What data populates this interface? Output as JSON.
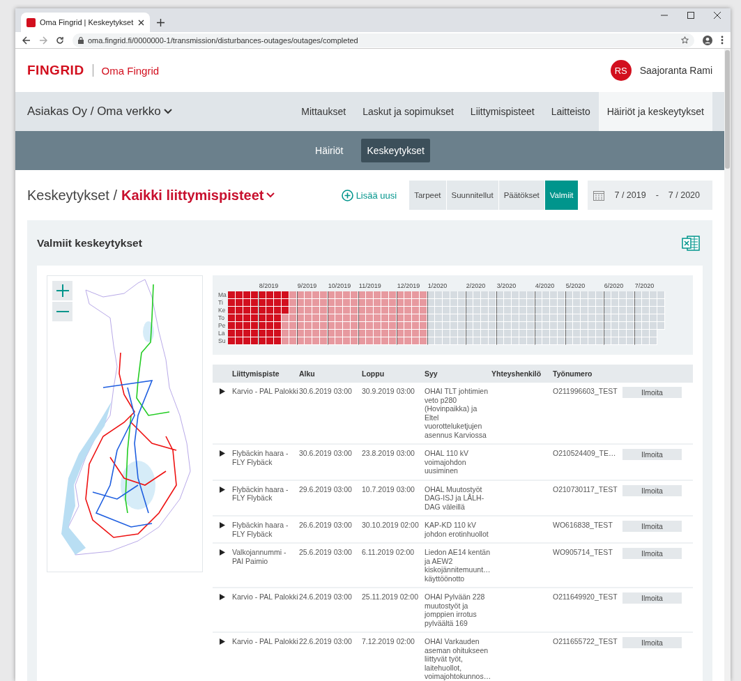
{
  "browser": {
    "tab_title": "Oma Fingrid | Keskeytykset",
    "url": "oma.fingrid.fi/0000000-1/transmission/disturbances-outages/outages/completed"
  },
  "header": {
    "logo": "FINGRID",
    "app_name": "Oma Fingrid",
    "user": {
      "initials": "RS",
      "name": "Saajoranta Rami"
    }
  },
  "nav": {
    "customer": "Asiakas Oy / Oma verkko",
    "items": [
      {
        "label": "Mittaukset",
        "selected": false
      },
      {
        "label": "Laskut ja sopimukset",
        "selected": false
      },
      {
        "label": "Liittymispisteet",
        "selected": false
      },
      {
        "label": "Laitteisto",
        "selected": false
      },
      {
        "label": "Häiriöt ja keskeytykset",
        "selected": true
      }
    ]
  },
  "subnav": [
    {
      "label": "Häiriöt",
      "selected": false
    },
    {
      "label": "Keskeytykset",
      "selected": true
    }
  ],
  "page": {
    "breadcrumb": "Keskeytykset /",
    "scope": "Kaikki liittymispisteet",
    "add_button": "Lisää uusi",
    "status_tabs": [
      {
        "label": "Tarpeet",
        "selected": false
      },
      {
        "label": "Suunnitellut",
        "selected": false
      },
      {
        "label": "Päätökset",
        "selected": false
      },
      {
        "label": "Valmiit",
        "selected": true
      }
    ],
    "date_range": {
      "from": "7 / 2019",
      "separator": "-",
      "to": "7 / 2020"
    }
  },
  "section": {
    "title": "Valmiit keskeytykset"
  },
  "calendar": {
    "day_labels": [
      "Ma",
      "Ti",
      "Ke",
      "To",
      "Pe",
      "La",
      "Su"
    ],
    "columns": [
      {
        "month_start": false
      },
      {
        "month_start": false
      },
      {
        "month_start": false
      },
      {
        "month_start": false
      },
      {
        "month_start": true,
        "label": "8/2019"
      },
      {
        "month_start": false
      },
      {
        "month_start": false
      },
      {
        "month_start": false
      },
      {
        "month_start": false
      },
      {
        "month_start": true,
        "label": "9/2019"
      },
      {
        "month_start": false
      },
      {
        "month_start": false
      },
      {
        "month_start": false
      },
      {
        "month_start": true,
        "label": "10/2019"
      },
      {
        "month_start": false
      },
      {
        "month_start": false
      },
      {
        "month_start": false
      },
      {
        "month_start": true,
        "label": "11/2019"
      },
      {
        "month_start": false
      },
      {
        "month_start": false
      },
      {
        "month_start": false
      },
      {
        "month_start": false
      },
      {
        "month_start": true,
        "label": "12/2019"
      },
      {
        "month_start": false
      },
      {
        "month_start": false
      },
      {
        "month_start": false
      },
      {
        "month_start": true,
        "label": "1/2020"
      },
      {
        "month_start": false
      },
      {
        "month_start": false
      },
      {
        "month_start": false
      },
      {
        "month_start": false
      },
      {
        "month_start": true,
        "label": "2/2020"
      },
      {
        "month_start": false
      },
      {
        "month_start": false
      },
      {
        "month_start": false
      },
      {
        "month_start": true,
        "label": "3/2020"
      },
      {
        "month_start": false
      },
      {
        "month_start": false
      },
      {
        "month_start": false
      },
      {
        "month_start": false
      },
      {
        "month_start": true,
        "label": "4/2020"
      },
      {
        "month_start": false
      },
      {
        "month_start": false
      },
      {
        "month_start": false
      },
      {
        "month_start": true,
        "label": "5/2020"
      },
      {
        "month_start": false
      },
      {
        "month_start": false
      },
      {
        "month_start": false
      },
      {
        "month_start": false
      },
      {
        "month_start": true,
        "label": "6/2020"
      },
      {
        "month_start": false
      },
      {
        "month_start": false
      },
      {
        "month_start": false
      },
      {
        "month_start": true,
        "label": "7/2020"
      },
      {
        "month_start": false
      },
      {
        "month_start": false
      },
      {
        "month_start": false
      }
    ],
    "rows": [
      {
        "cells": [
          {
            "color": "#d20f1e"
          },
          {
            "color": "#d20f1e"
          },
          {
            "color": "#d20f1e"
          },
          {
            "color": "#d20f1e"
          },
          {
            "color": "#d20f1e"
          },
          {
            "color": "#d20f1e"
          },
          {
            "color": "#d20f1e"
          },
          {
            "color": "#d20f1e"
          },
          {
            "color": "#e7999f"
          },
          {
            "color": "#e7999f"
          },
          {
            "color": "#e7999f"
          },
          {
            "color": "#e7999f"
          },
          {
            "color": "#e7999f"
          },
          {
            "color": "#e7999f"
          },
          {
            "color": "#e7999f"
          },
          {
            "color": "#e7999f"
          },
          {
            "color": "#e7999f"
          },
          {
            "color": "#e7999f"
          },
          {
            "color": "#e7999f"
          },
          {
            "color": "#e7999f"
          },
          {
            "color": "#e7999f"
          },
          {
            "color": "#e7999f"
          },
          {
            "color": "#e7999f"
          },
          {
            "color": "#e7999f"
          },
          {
            "color": "#e7999f"
          },
          {
            "color": "#e7999f"
          },
          {
            "color": "#d6dce1"
          },
          {
            "color": "#d6dce1"
          },
          {
            "color": "#d6dce1"
          },
          {
            "color": "#d6dce1"
          },
          {
            "color": "#d6dce1"
          },
          {
            "color": "#d6dce1"
          },
          {
            "color": "#d6dce1"
          },
          {
            "color": "#d6dce1"
          },
          {
            "color": "#d6dce1"
          },
          {
            "color": "#d6dce1"
          },
          {
            "color": "#d6dce1"
          },
          {
            "color": "#d6dce1"
          },
          {
            "color": "#d6dce1"
          },
          {
            "color": "#d6dce1"
          },
          {
            "color": "#d6dce1"
          },
          {
            "color": "#d6dce1"
          },
          {
            "color": "#d6dce1"
          },
          {
            "color": "#d6dce1"
          },
          {
            "color": "#d6dce1"
          },
          {
            "color": "#d6dce1"
          },
          {
            "color": "#d6dce1"
          },
          {
            "color": "#d6dce1"
          },
          {
            "color": "#d6dce1"
          },
          {
            "color": "#d6dce1"
          },
          {
            "color": "#d6dce1"
          },
          {
            "color": "#d6dce1"
          },
          {
            "color": "#d6dce1"
          },
          {
            "color": "#d6dce1"
          },
          {
            "color": "#d6dce1"
          },
          {
            "color": "#d6dce1"
          },
          {
            "color": "#d6dce1"
          }
        ]
      },
      {
        "cells": [
          {
            "color": "#d20f1e"
          },
          {
            "color": "#d20f1e"
          },
          {
            "color": "#d20f1e"
          },
          {
            "color": "#d20f1e"
          },
          {
            "color": "#d20f1e"
          },
          {
            "color": "#d20f1e"
          },
          {
            "color": "#d20f1e"
          },
          {
            "color": "#d20f1e"
          },
          {
            "color": "#e7999f"
          },
          {
            "color": "#e7999f"
          },
          {
            "color": "#e7999f"
          },
          {
            "color": "#e7999f"
          },
          {
            "color": "#e7999f"
          },
          {
            "color": "#e7999f"
          },
          {
            "color": "#e7999f"
          },
          {
            "color": "#e7999f"
          },
          {
            "color": "#e7999f"
          },
          {
            "color": "#e7999f"
          },
          {
            "color": "#e7999f"
          },
          {
            "color": "#e7999f"
          },
          {
            "color": "#e7999f"
          },
          {
            "color": "#e7999f"
          },
          {
            "color": "#e7999f"
          },
          {
            "color": "#e7999f"
          },
          {
            "color": "#e7999f"
          },
          {
            "color": "#e7999f"
          },
          {
            "color": "#d6dce1"
          },
          {
            "color": "#d6dce1"
          },
          {
            "color": "#d6dce1"
          },
          {
            "color": "#d6dce1"
          },
          {
            "color": "#d6dce1"
          },
          {
            "color": "#d6dce1"
          },
          {
            "color": "#d6dce1"
          },
          {
            "color": "#d6dce1"
          },
          {
            "color": "#d6dce1"
          },
          {
            "color": "#d6dce1"
          },
          {
            "color": "#d6dce1"
          },
          {
            "color": "#d6dce1"
          },
          {
            "color": "#d6dce1"
          },
          {
            "color": "#d6dce1"
          },
          {
            "color": "#d6dce1"
          },
          {
            "color": "#d6dce1"
          },
          {
            "color": "#d6dce1"
          },
          {
            "color": "#d6dce1"
          },
          {
            "color": "#d6dce1"
          },
          {
            "color": "#d6dce1"
          },
          {
            "color": "#d6dce1"
          },
          {
            "color": "#d6dce1"
          },
          {
            "color": "#d6dce1"
          },
          {
            "color": "#d6dce1"
          },
          {
            "color": "#d6dce1"
          },
          {
            "color": "#d6dce1"
          },
          {
            "color": "#d6dce1"
          },
          {
            "color": "#d6dce1"
          },
          {
            "color": "#d6dce1"
          },
          {
            "color": "#d6dce1"
          },
          {
            "color": "#d6dce1"
          }
        ]
      },
      {
        "cells": [
          {
            "color": "#d20f1e"
          },
          {
            "color": "#d20f1e"
          },
          {
            "color": "#d20f1e"
          },
          {
            "color": "#d20f1e"
          },
          {
            "color": "#d20f1e"
          },
          {
            "color": "#d20f1e"
          },
          {
            "color": "#d20f1e"
          },
          {
            "color": "#d20f1e"
          },
          {
            "color": "#e7999f"
          },
          {
            "color": "#e7999f"
          },
          {
            "color": "#e7999f"
          },
          {
            "color": "#e7999f"
          },
          {
            "color": "#e7999f"
          },
          {
            "color": "#e7999f"
          },
          {
            "color": "#e7999f"
          },
          {
            "color": "#e7999f"
          },
          {
            "color": "#e7999f"
          },
          {
            "color": "#e7999f"
          },
          {
            "color": "#e7999f"
          },
          {
            "color": "#e7999f"
          },
          {
            "color": "#e7999f"
          },
          {
            "color": "#e7999f"
          },
          {
            "color": "#e7999f"
          },
          {
            "color": "#e7999f"
          },
          {
            "color": "#e7999f"
          },
          {
            "color": "#e7999f"
          },
          {
            "color": "#d6dce1"
          },
          {
            "color": "#d6dce1"
          },
          {
            "color": "#d6dce1"
          },
          {
            "color": "#d6dce1"
          },
          {
            "color": "#d6dce1"
          },
          {
            "color": "#d6dce1"
          },
          {
            "color": "#d6dce1"
          },
          {
            "color": "#d6dce1"
          },
          {
            "color": "#d6dce1"
          },
          {
            "color": "#d6dce1"
          },
          {
            "color": "#d6dce1"
          },
          {
            "color": "#d6dce1"
          },
          {
            "color": "#d6dce1"
          },
          {
            "color": "#d6dce1"
          },
          {
            "color": "#d6dce1"
          },
          {
            "color": "#d6dce1"
          },
          {
            "color": "#d6dce1"
          },
          {
            "color": "#d6dce1"
          },
          {
            "color": "#d6dce1"
          },
          {
            "color": "#d6dce1"
          },
          {
            "color": "#d6dce1"
          },
          {
            "color": "#d6dce1"
          },
          {
            "color": "#d6dce1"
          },
          {
            "color": "#d6dce1"
          },
          {
            "color": "#d6dce1"
          },
          {
            "color": "#d6dce1"
          },
          {
            "color": "#d6dce1"
          },
          {
            "color": "#d6dce1"
          },
          {
            "color": "#d6dce1"
          },
          {
            "color": "#d6dce1"
          },
          {
            "color": "#d6dce1"
          }
        ]
      },
      {
        "cells": [
          {
            "color": "#d20f1e"
          },
          {
            "color": "#d20f1e"
          },
          {
            "color": "#d20f1e"
          },
          {
            "color": "#d20f1e"
          },
          {
            "color": "#d20f1e"
          },
          {
            "color": "#d20f1e"
          },
          {
            "color": "#d20f1e"
          },
          {
            "color": "#e7999f"
          },
          {
            "color": "#e7999f"
          },
          {
            "color": "#e7999f"
          },
          {
            "color": "#e7999f"
          },
          {
            "color": "#e7999f"
          },
          {
            "color": "#e7999f"
          },
          {
            "color": "#e7999f"
          },
          {
            "color": "#e7999f"
          },
          {
            "color": "#e7999f"
          },
          {
            "color": "#e7999f"
          },
          {
            "color": "#e7999f"
          },
          {
            "color": "#e7999f"
          },
          {
            "color": "#e7999f"
          },
          {
            "color": "#e7999f"
          },
          {
            "color": "#e7999f"
          },
          {
            "color": "#e7999f"
          },
          {
            "color": "#e7999f"
          },
          {
            "color": "#e7999f"
          },
          {
            "color": "#e7999f"
          },
          {
            "color": "#d6dce1"
          },
          {
            "color": "#d6dce1"
          },
          {
            "color": "#d6dce1"
          },
          {
            "color": "#d6dce1"
          },
          {
            "color": "#d6dce1"
          },
          {
            "color": "#d6dce1"
          },
          {
            "color": "#d6dce1"
          },
          {
            "color": "#d6dce1"
          },
          {
            "color": "#d6dce1"
          },
          {
            "color": "#d6dce1"
          },
          {
            "color": "#d6dce1"
          },
          {
            "color": "#d6dce1"
          },
          {
            "color": "#d6dce1"
          },
          {
            "color": "#d6dce1"
          },
          {
            "color": "#d6dce1"
          },
          {
            "color": "#d6dce1"
          },
          {
            "color": "#d6dce1"
          },
          {
            "color": "#d6dce1"
          },
          {
            "color": "#d6dce1"
          },
          {
            "color": "#d6dce1"
          },
          {
            "color": "#d6dce1"
          },
          {
            "color": "#d6dce1"
          },
          {
            "color": "#d6dce1"
          },
          {
            "color": "#d6dce1"
          },
          {
            "color": "#d6dce1"
          },
          {
            "color": "#d6dce1"
          },
          {
            "color": "#d6dce1"
          },
          {
            "color": "#d6dce1"
          },
          {
            "color": "#d6dce1"
          },
          {
            "color": "#d6dce1"
          },
          {
            "color": "#d6dce1"
          }
        ]
      },
      {
        "cells": [
          {
            "color": "#d20f1e"
          },
          {
            "color": "#d20f1e"
          },
          {
            "color": "#d20f1e"
          },
          {
            "color": "#d20f1e"
          },
          {
            "color": "#d20f1e"
          },
          {
            "color": "#d20f1e"
          },
          {
            "color": "#d20f1e"
          },
          {
            "color": "#e7999f"
          },
          {
            "color": "#e7999f"
          },
          {
            "color": "#e7999f"
          },
          {
            "color": "#e7999f"
          },
          {
            "color": "#e7999f"
          },
          {
            "color": "#e7999f"
          },
          {
            "color": "#e7999f"
          },
          {
            "color": "#e7999f"
          },
          {
            "color": "#e7999f"
          },
          {
            "color": "#e7999f"
          },
          {
            "color": "#e7999f"
          },
          {
            "color": "#e7999f"
          },
          {
            "color": "#e7999f"
          },
          {
            "color": "#e7999f"
          },
          {
            "color": "#e7999f"
          },
          {
            "color": "#e7999f"
          },
          {
            "color": "#e7999f"
          },
          {
            "color": "#e7999f"
          },
          {
            "color": "#e7999f"
          },
          {
            "color": "#d6dce1"
          },
          {
            "color": "#d6dce1"
          },
          {
            "color": "#d6dce1"
          },
          {
            "color": "#d6dce1"
          },
          {
            "color": "#d6dce1"
          },
          {
            "color": "#d6dce1"
          },
          {
            "color": "#d6dce1"
          },
          {
            "color": "#d6dce1"
          },
          {
            "color": "#d6dce1"
          },
          {
            "color": "#d6dce1"
          },
          {
            "color": "#d6dce1"
          },
          {
            "color": "#d6dce1"
          },
          {
            "color": "#d6dce1"
          },
          {
            "color": "#d6dce1"
          },
          {
            "color": "#d6dce1"
          },
          {
            "color": "#d6dce1"
          },
          {
            "color": "#d6dce1"
          },
          {
            "color": "#d6dce1"
          },
          {
            "color": "#d6dce1"
          },
          {
            "color": "#d6dce1"
          },
          {
            "color": "#d6dce1"
          },
          {
            "color": "#d6dce1"
          },
          {
            "color": "#d6dce1"
          },
          {
            "color": "#d6dce1"
          },
          {
            "color": "#d6dce1"
          },
          {
            "color": "#d6dce1"
          },
          {
            "color": "#d6dce1"
          },
          {
            "color": "#d6dce1"
          },
          {
            "color": "#d6dce1"
          },
          {
            "color": "#d6dce1"
          },
          {
            "color": "#d6dce1"
          }
        ]
      },
      {
        "cells": [
          {
            "color": "#d20f1e"
          },
          {
            "color": "#d20f1e"
          },
          {
            "color": "#d20f1e"
          },
          {
            "color": "#d20f1e"
          },
          {
            "color": "#d20f1e"
          },
          {
            "color": "#d20f1e"
          },
          {
            "color": "#d20f1e"
          },
          {
            "color": "#e7999f"
          },
          {
            "color": "#e7999f"
          },
          {
            "color": "#e7999f"
          },
          {
            "color": "#e7999f"
          },
          {
            "color": "#e7999f"
          },
          {
            "color": "#e7999f"
          },
          {
            "color": "#e7999f"
          },
          {
            "color": "#e7999f"
          },
          {
            "color": "#e7999f"
          },
          {
            "color": "#e7999f"
          },
          {
            "color": "#e7999f"
          },
          {
            "color": "#e7999f"
          },
          {
            "color": "#e7999f"
          },
          {
            "color": "#e7999f"
          },
          {
            "color": "#e7999f"
          },
          {
            "color": "#e7999f"
          },
          {
            "color": "#e7999f"
          },
          {
            "color": "#e7999f"
          },
          {
            "color": "#e7999f"
          },
          {
            "color": "#d6dce1"
          },
          {
            "color": "#d6dce1"
          },
          {
            "color": "#d6dce1"
          },
          {
            "color": "#d6dce1"
          },
          {
            "color": "#d6dce1"
          },
          {
            "color": "#d6dce1"
          },
          {
            "color": "#d6dce1"
          },
          {
            "color": "#d6dce1"
          },
          {
            "color": "#d6dce1"
          },
          {
            "color": "#d6dce1"
          },
          {
            "color": "#d6dce1"
          },
          {
            "color": "#d6dce1"
          },
          {
            "color": "#d6dce1"
          },
          {
            "color": "#d6dce1"
          },
          {
            "color": "#d6dce1"
          },
          {
            "color": "#d6dce1"
          },
          {
            "color": "#d6dce1"
          },
          {
            "color": "#d6dce1"
          },
          {
            "color": "#d6dce1"
          },
          {
            "color": "#d6dce1"
          },
          {
            "color": "#d6dce1"
          },
          {
            "color": "#d6dce1"
          },
          {
            "color": "#d6dce1"
          },
          {
            "color": "#d6dce1"
          },
          {
            "color": "#d6dce1"
          },
          {
            "color": "#d6dce1"
          },
          {
            "color": "#d6dce1"
          },
          {
            "color": "#d6dce1"
          },
          {
            "color": "#d6dce1"
          },
          {
            "color": "#d6dce1"
          }
        ]
      },
      {
        "cells": [
          {
            "color": "#d20f1e"
          },
          {
            "color": "#d20f1e"
          },
          {
            "color": "#d20f1e"
          },
          {
            "color": "#d20f1e"
          },
          {
            "color": "#d20f1e"
          },
          {
            "color": "#d20f1e"
          },
          {
            "color": "#d20f1e"
          },
          {
            "color": "#e7999f"
          },
          {
            "color": "#e7999f"
          },
          {
            "color": "#e7999f"
          },
          {
            "color": "#e7999f"
          },
          {
            "color": "#e7999f"
          },
          {
            "color": "#e7999f"
          },
          {
            "color": "#e7999f"
          },
          {
            "color": "#e7999f"
          },
          {
            "color": "#e7999f"
          },
          {
            "color": "#e7999f"
          },
          {
            "color": "#e7999f"
          },
          {
            "color": "#e7999f"
          },
          {
            "color": "#e7999f"
          },
          {
            "color": "#e7999f"
          },
          {
            "color": "#e7999f"
          },
          {
            "color": "#e7999f"
          },
          {
            "color": "#e7999f"
          },
          {
            "color": "#e7999f"
          },
          {
            "color": "#e7999f"
          },
          {
            "color": "#d6dce1"
          },
          {
            "color": "#d6dce1"
          },
          {
            "color": "#d6dce1"
          },
          {
            "color": "#d6dce1"
          },
          {
            "color": "#d6dce1"
          },
          {
            "color": "#d6dce1"
          },
          {
            "color": "#d6dce1"
          },
          {
            "color": "#d6dce1"
          },
          {
            "color": "#d6dce1"
          },
          {
            "color": "#d6dce1"
          },
          {
            "color": "#d6dce1"
          },
          {
            "color": "#d6dce1"
          },
          {
            "color": "#d6dce1"
          },
          {
            "color": "#d6dce1"
          },
          {
            "color": "#d6dce1"
          },
          {
            "color": "#d6dce1"
          },
          {
            "color": "#d6dce1"
          },
          {
            "color": "#d6dce1"
          },
          {
            "color": "#d6dce1"
          },
          {
            "color": "#d6dce1"
          },
          {
            "color": "#d6dce1"
          },
          {
            "color": "#d6dce1"
          },
          {
            "color": "#d6dce1"
          },
          {
            "color": "#d6dce1"
          },
          {
            "color": "#d6dce1"
          },
          {
            "color": "#d6dce1"
          },
          {
            "color": "#d6dce1"
          },
          {
            "color": "#d6dce1"
          },
          {
            "color": "#d6dce1"
          },
          {
            "color": "#d6dce1"
          }
        ]
      }
    ]
  },
  "table": {
    "columns": [
      "Liittymispiste",
      "Alku",
      "Loppu",
      "Syy",
      "Yhteyshenkilö",
      "Työnumero"
    ],
    "rows": [
      {
        "point": "Karvio - PAL Palokki",
        "start": "30.6.2019 03:00",
        "end": "30.9.2019 03:00",
        "reason": "OHAI TLT johtimien veto p280 (Hovinpaikka) ja Eltel vuorotteluketjujen asennus Karviossa",
        "work_number": "O211996603_TEST",
        "action": "Ilmoita"
      },
      {
        "point": "Flybäckin haara - FLY Flybäck",
        "start": "30.6.2019 03:00",
        "end": "23.8.2019 03:00",
        "reason": "OHAL 110 kV voimajohdon uusiminen",
        "work_number": "O210524409_TE…",
        "action": "Ilmoita"
      },
      {
        "point": "Flybäckin haara - FLY Flybäck",
        "start": "29.6.2019 03:00",
        "end": "10.7.2019 03:00",
        "reason": "OHAL Muutostyöt DAG-ISJ ja LÅLH-DAG väleillä",
        "work_number": "O210730117_TEST",
        "action": "Ilmoita"
      },
      {
        "point": "Flybäckin haara - FLY Flybäck",
        "start": "26.6.2019 03:00",
        "end": "30.10.2019 02:00",
        "reason": "KAP-KD 110 kV johdon erotinhuollot",
        "work_number": "WO616838_TEST",
        "action": "Ilmoita"
      },
      {
        "point": "Valkojannummi - PAI Paimio",
        "start": "25.6.2019 03:00",
        "end": "6.11.2019 02:00",
        "reason": "Liedon AE14 kentän ja AEW2 kiskojännitemuunt… käyttöönotto",
        "work_number": "WO905714_TEST",
        "action": "Ilmoita"
      },
      {
        "point": "Karvio - PAL Palokki",
        "start": "24.6.2019 03:00",
        "end": "25.11.2019 02:00",
        "reason": "OHAI Pylvään 228 muutostyöt ja jomppien irrotus pylväältä 169",
        "work_number": "O211649920_TEST",
        "action": "Ilmoita"
      },
      {
        "point": "Karvio - PAL Palokki",
        "start": "22.6.2019 03:00",
        "end": "7.12.2019 02:00",
        "reason": "OHAI Varkauden aseman ohitukseen liittyvät työt, laitehuollot, voimajohtokunnos…",
        "work_number": "O211655722_TEST",
        "action": "Ilmoita"
      }
    ]
  }
}
